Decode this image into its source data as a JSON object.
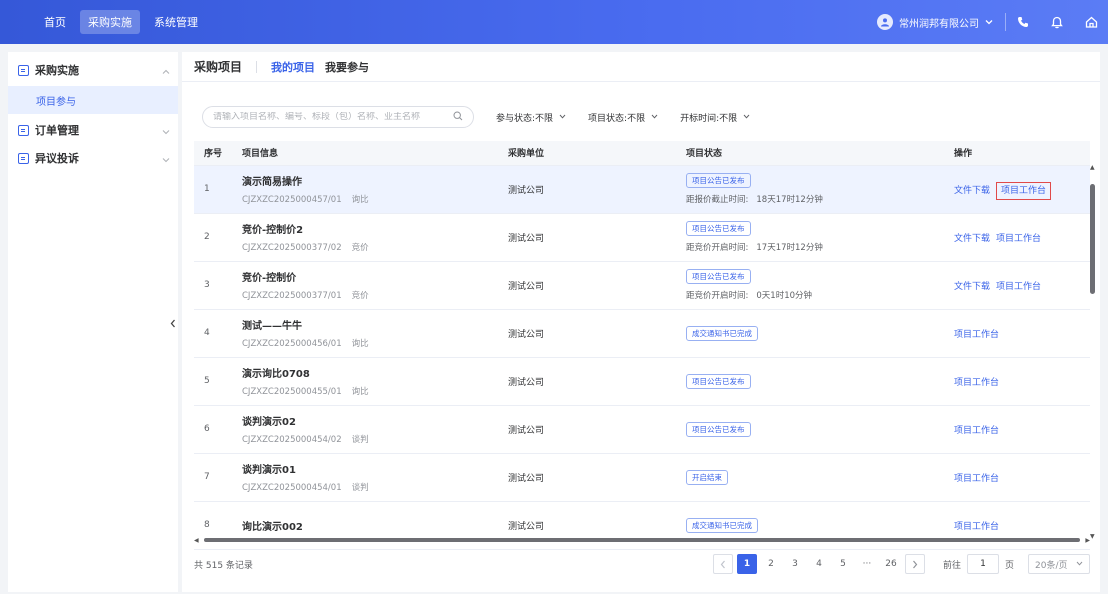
{
  "topbar": {
    "nav": [
      "首页",
      "采购实施",
      "系统管理"
    ],
    "active_nav": 1,
    "company": "常州润邦有限公司",
    "icons": [
      "phone-icon",
      "bell-icon",
      "home-icon"
    ]
  },
  "sidebar": {
    "groups": [
      {
        "label": "采购实施",
        "expanded": true,
        "items": [
          "项目参与"
        ]
      },
      {
        "label": "订单管理",
        "expanded": false
      },
      {
        "label": "异议投诉",
        "expanded": false
      }
    ]
  },
  "main": {
    "title": "采购项目",
    "tabs": [
      "我的项目",
      "我要参与"
    ],
    "active_tab": 0,
    "search_placeholder": "请输入项目名称、编号、标段（包）名称、业主名称",
    "filters": [
      "参与状态:不限",
      "项目状态:不限",
      "开标时间:不限"
    ]
  },
  "table": {
    "headers": [
      "序号",
      "项目信息",
      "采购单位",
      "项目状态",
      "操作"
    ],
    "rows": [
      {
        "idx": "1",
        "name": "演示简易操作",
        "code": "CJZXZC2025000457/01",
        "type": "询比",
        "unit": "测试公司",
        "status": "项目公告已发布",
        "hint_label": "距报价截止时间:",
        "hint_value": "18天17时12分钟",
        "actions": [
          "文件下载",
          "项目工作台"
        ],
        "highlight": true
      },
      {
        "idx": "2",
        "name": "竞价-控制价2",
        "code": "CJZXZC2025000377/02",
        "type": "竞价",
        "unit": "测试公司",
        "status": "项目公告已发布",
        "hint_label": "距竞价开启时间:",
        "hint_value": "17天17时12分钟",
        "actions": [
          "文件下载",
          "项目工作台"
        ]
      },
      {
        "idx": "3",
        "name": "竞价-控制价",
        "code": "CJZXZC2025000377/01",
        "type": "竞价",
        "unit": "测试公司",
        "status": "项目公告已发布",
        "hint_label": "距竞价开启时间:",
        "hint_value": "0天1时10分钟",
        "actions": [
          "文件下载",
          "项目工作台"
        ]
      },
      {
        "idx": "4",
        "name": "测试——牛牛",
        "code": "CJZXZC2025000456/01",
        "type": "询比",
        "unit": "测试公司",
        "status": "成交通知书已完成",
        "hint_label": "",
        "hint_value": "",
        "actions": [
          "项目工作台"
        ]
      },
      {
        "idx": "5",
        "name": "演示询比0708",
        "code": "CJZXZC2025000455/01",
        "type": "询比",
        "unit": "测试公司",
        "status": "项目公告已发布",
        "hint_label": "",
        "hint_value": "",
        "actions": [
          "项目工作台"
        ]
      },
      {
        "idx": "6",
        "name": "谈判演示02",
        "code": "CJZXZC2025000454/02",
        "type": "谈判",
        "unit": "测试公司",
        "status": "项目公告已发布",
        "hint_label": "",
        "hint_value": "",
        "actions": [
          "项目工作台"
        ]
      },
      {
        "idx": "7",
        "name": "谈判演示01",
        "code": "CJZXZC2025000454/01",
        "type": "谈判",
        "unit": "测试公司",
        "status": "开启结束",
        "hint_label": "",
        "hint_value": "",
        "actions": [
          "项目工作台"
        ]
      },
      {
        "idx": "8",
        "name": "询比演示002",
        "code": "",
        "type": "",
        "unit": "测试公司",
        "status": "成交通知书已完成",
        "hint_label": "",
        "hint_value": "",
        "actions": [
          "项目工作台"
        ]
      }
    ],
    "boxed_action": {
      "row": 0,
      "label": "项目工作台"
    }
  },
  "footer": {
    "total": "共 515 条记录",
    "pages": [
      "1",
      "2",
      "3",
      "4",
      "5",
      "···",
      "26"
    ],
    "current_page": "1",
    "goto_label": "前往",
    "goto_value": "1",
    "page_suffix": "页",
    "page_size": "20条/页"
  }
}
